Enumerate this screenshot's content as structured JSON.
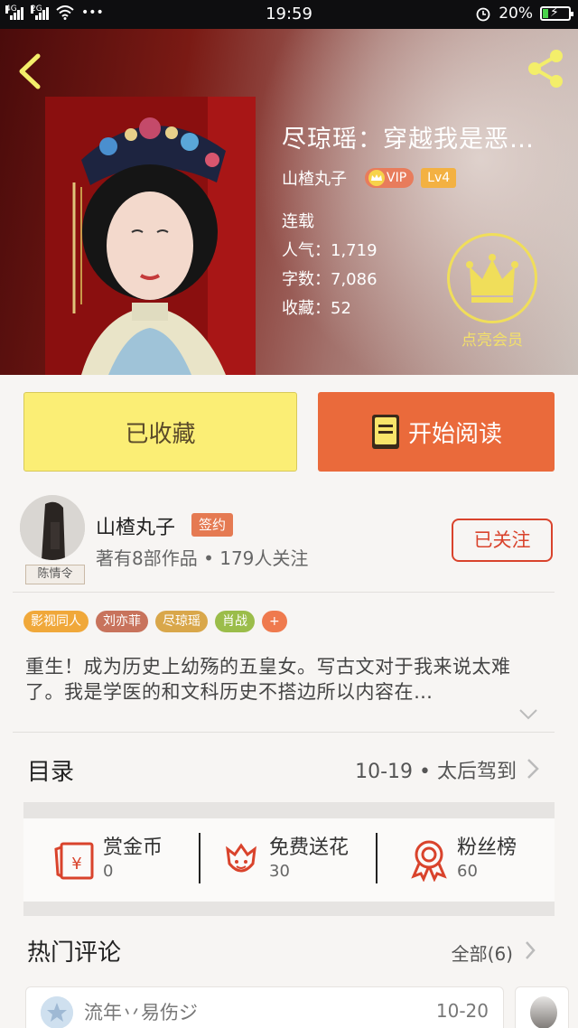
{
  "status_bar": {
    "network1": "4G",
    "network2": "2G",
    "dots": "•••",
    "time": "19:59",
    "battery": "20%",
    "battery_level": 0.2
  },
  "book": {
    "title": "尽琼瑶：穿越我是恶…",
    "author": "山楂丸子",
    "vip": "VIP",
    "level": "Lv4",
    "status": "连载",
    "popularity": "人气：1,719",
    "word_count": "字数：7,086",
    "favorites": "收藏：52",
    "member_label": "点亮会员"
  },
  "actions": {
    "collected": "已收藏",
    "start_reading": "开始阅读"
  },
  "author_card": {
    "name": "山楂丸子",
    "signed": "签约",
    "meta": "著有8部作品 • 179人关注",
    "avatar_tag": "陈情令",
    "follow": "已关注"
  },
  "tags": [
    {
      "label": "影视同人",
      "color": "#f0a83a"
    },
    {
      "label": "刘亦菲",
      "color": "#c8735c"
    },
    {
      "label": "尽琼瑶",
      "color": "#d9a74a"
    },
    {
      "label": "肖战",
      "color": "#9bbd4a"
    },
    {
      "label": "+",
      "color": "#ef7a4e"
    }
  ],
  "description": "重生！成为历史上幼殇的五皇女。写古文对于我来说太难了。我是学医的和文科历史不搭边所以内容在…",
  "catalog": {
    "label": "目录",
    "latest": "10-19 • 太后驾到"
  },
  "rewards": [
    {
      "label": "赏金币",
      "count": "0",
      "icon": "red-envelope-icon"
    },
    {
      "label": "免费送花",
      "count": "30",
      "icon": "flower-icon"
    },
    {
      "label": "粉丝榜",
      "count": "60",
      "icon": "medal-icon"
    }
  ],
  "comments": {
    "title": "热门评论",
    "all": "全部(6)",
    "first": {
      "user": "流年丷易伤ジ",
      "date": "10-20"
    }
  },
  "colors": {
    "accent_orange": "#ea6a3b",
    "collect_yellow": "#fbee75",
    "follow_red": "#d9432c",
    "member_gold": "#f0de5a"
  }
}
